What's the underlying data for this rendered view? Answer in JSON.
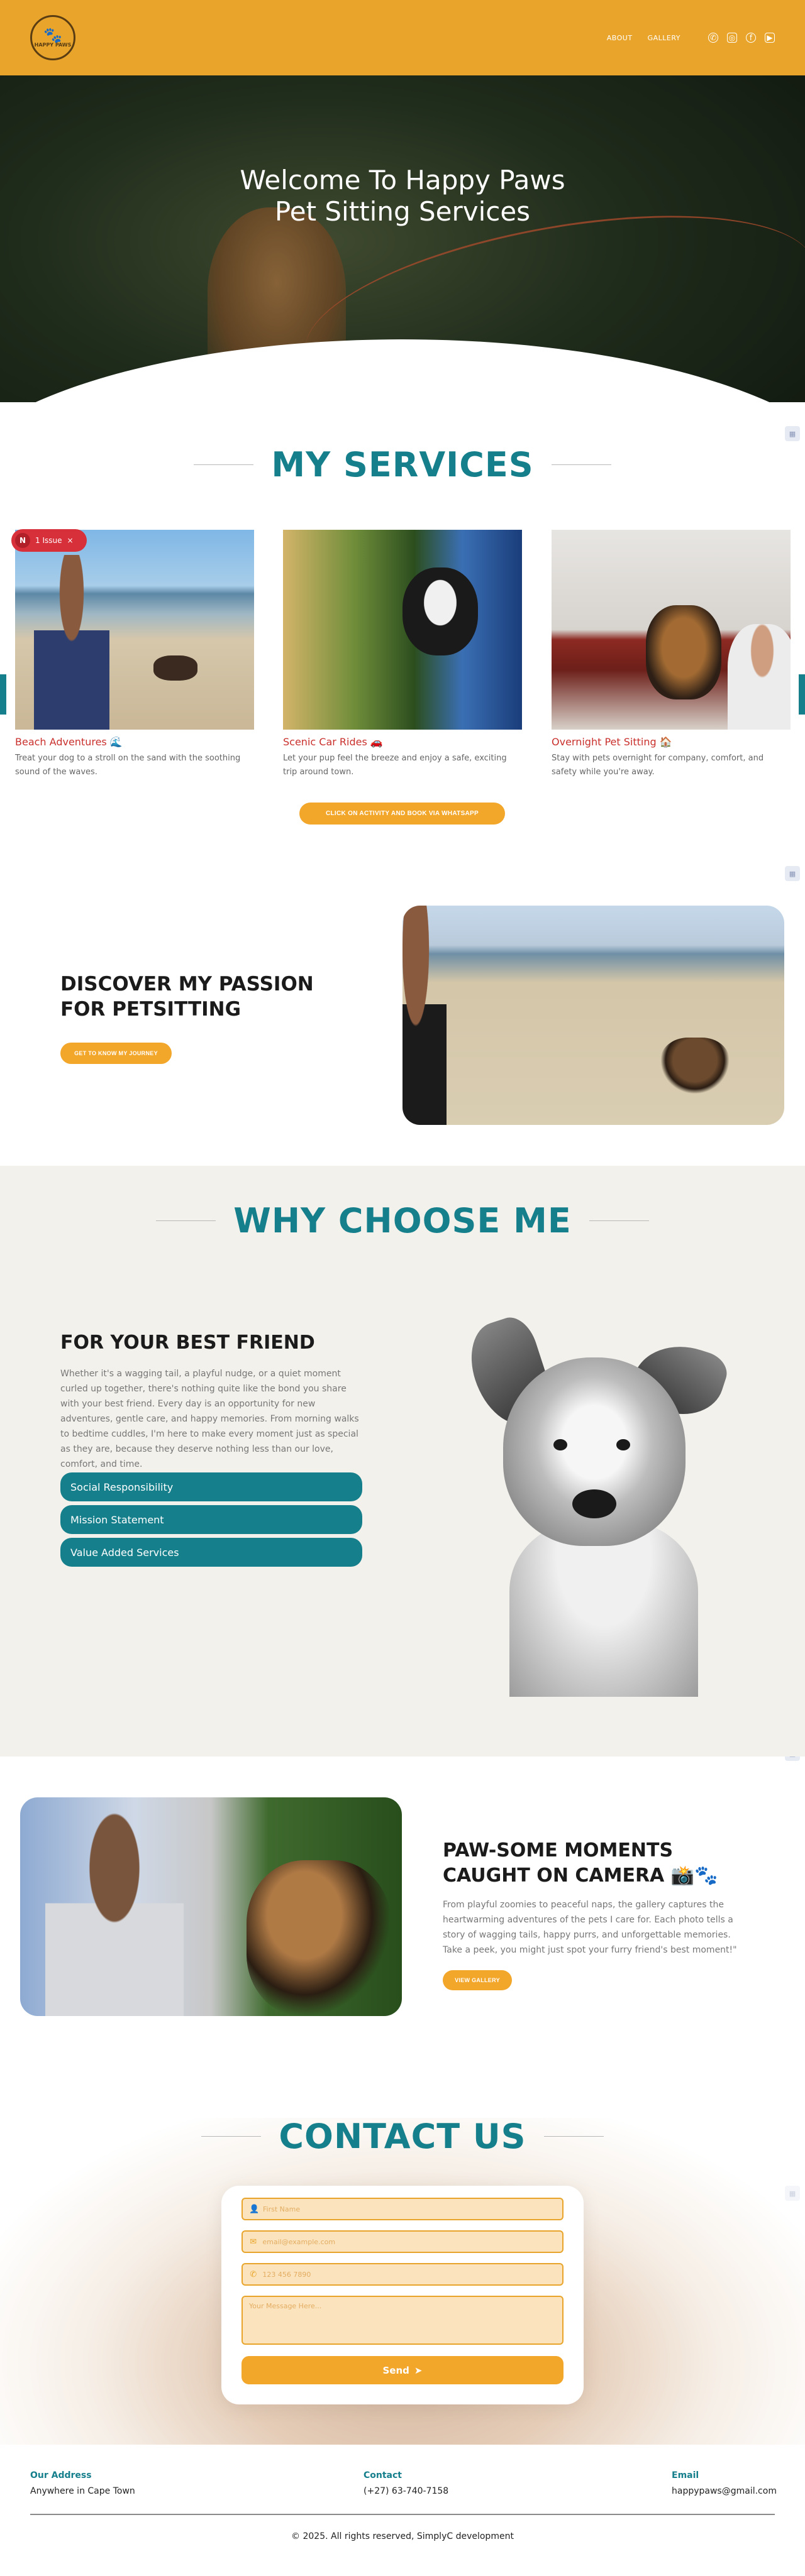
{
  "header": {
    "logo_text": "HAPPY PAWS",
    "nav": [
      "ABOUT",
      "GALLERY"
    ],
    "socials": [
      "whatsapp-icon",
      "instagram-icon",
      "facebook-icon",
      "youtube-icon"
    ]
  },
  "hero": {
    "title_line1": "Welcome To Happy Paws",
    "title_line2": "Pet Sitting Services"
  },
  "services": {
    "title": "MY SERVICES",
    "items": [
      {
        "name": "Beach Adventures 🌊",
        "desc": "Treat your dog to a stroll on the sand with the soothing sound of the waves."
      },
      {
        "name": "Scenic Car Rides 🚗",
        "desc": "Let your pup feel the breeze and enjoy a safe, exciting trip around town."
      },
      {
        "name": "Overnight Pet Sitting 🏠",
        "desc": "Stay with pets overnight for company, comfort, and safety while you're away."
      }
    ],
    "cta": "CLICK ON ACTIVITY AND BOOK VIA WHATSAPP"
  },
  "issue_badge": {
    "letter": "N",
    "label": "1 Issue",
    "close": "×"
  },
  "passion": {
    "title_line1": "DISCOVER MY PASSION",
    "title_line2": "FOR PETSITTING",
    "button": "GET TO KNOW MY JOURNEY"
  },
  "why": {
    "title": "WHY CHOOSE ME",
    "subtitle": "FOR YOUR BEST FRIEND",
    "text": "Whether it's a wagging tail, a playful nudge, or a quiet moment curled up together, there's nothing quite like the bond you share with your best friend. Every day is an opportunity for new adventures, gentle care, and happy memories. From morning walks to bedtime cuddles, I'm here to make every moment just as special as they are, because they deserve nothing less than our love, comfort, and time.",
    "accordion": [
      "Social Responsibility",
      "Mission Statement",
      "Value Added Services"
    ]
  },
  "moments": {
    "title_line1": "PAW-SOME MOMENTS",
    "title_line2": "CAUGHT ON CAMERA 📸🐾",
    "text": "From playful zoomies to peaceful naps, the gallery captures the heartwarming adventures of the pets I care for. Each photo tells a story of wagging tails, happy purrs, and unforgettable memories. Take a peek, you might just spot your furry friend's best moment!\"",
    "button": "VIEW GALLERY"
  },
  "contact": {
    "title": "CONTACT US",
    "name_placeholder": "First Name",
    "email_placeholder": "email@example.com",
    "phone_placeholder": "123 456 7890",
    "message_placeholder": "Your Message Here...",
    "send_label": "Send"
  },
  "footer": {
    "address_label": "Our Address",
    "address_value": "Anywhere in Cape Town",
    "contact_label": "Contact",
    "contact_value": "(+27) 63-740-7158",
    "email_label": "Email",
    "email_value": "happypaws@gmail.com",
    "copyright": "© 2025. All rights reserved, SimplyC development"
  }
}
